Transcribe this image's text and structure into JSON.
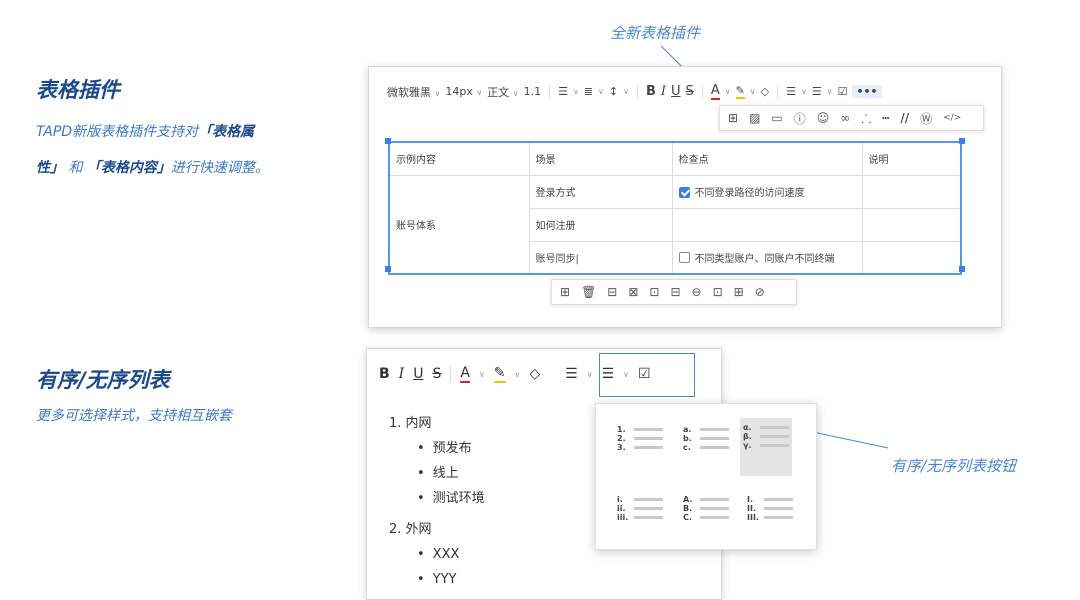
{
  "section1": {
    "title": "表格插件",
    "desc_line1": "TAPD新版表格插件支持对",
    "desc_bold1": "「表格属",
    "desc_bold2": "性」",
    "desc_mid": "和",
    "desc_bold3": "「表格内容」",
    "desc_end": "进行快速调整。",
    "callout": "全新表格插件"
  },
  "editor1": {
    "font": "微软雅黑",
    "size": "14px",
    "paragraph": "正文",
    "lineheight": "1.1",
    "toolbar_icons": [
      "align-icon",
      "indent-icon",
      "line-spacing-icon",
      "bold-icon",
      "italic-icon",
      "underline-icon",
      "strikethrough-icon",
      "font-color-icon",
      "highlight-icon",
      "clear-format-icon",
      "ordered-list-icon",
      "unordered-list-icon",
      "checklist-icon",
      "more-icon"
    ],
    "table": {
      "headers": [
        "示例内容",
        "场景",
        "检查点",
        "说明"
      ],
      "group": "账号体系",
      "rows": [
        {
          "scene": "登录方式",
          "check": "不同登录路径的访问速度",
          "checked": true
        },
        {
          "scene": "如何注册",
          "check": "",
          "checked": null
        },
        {
          "scene": "账号同步",
          "check": "不同类型账户、同账户不同终端",
          "checked": false
        }
      ]
    }
  },
  "section2": {
    "title": "有序/无序列表",
    "desc": "更多可选择样式，支持相互嵌套",
    "callout": "有序/无序列表按钮"
  },
  "editor2": {
    "toolbar_labels": [
      "B",
      "I",
      "U",
      "S",
      "A"
    ],
    "list_styles": [
      {
        "markers": [
          "1.",
          "2.",
          "3."
        ],
        "selected": false
      },
      {
        "markers": [
          "a.",
          "b.",
          "c."
        ],
        "selected": false
      },
      {
        "markers": [
          "α.",
          "β.",
          "γ."
        ],
        "selected": true
      },
      {
        "markers": [
          "i.",
          "ii.",
          "iii."
        ],
        "selected": false
      },
      {
        "markers": [
          "A.",
          "B.",
          "C."
        ],
        "selected": false
      },
      {
        "markers": [
          "I.",
          "II.",
          "III."
        ],
        "selected": false
      }
    ],
    "list": [
      {
        "label": "1. 内网",
        "children": [
          "预发布",
          "线上",
          "测试环境"
        ]
      },
      {
        "label": "2. 外网",
        "children": [
          "XXX",
          "YYY"
        ]
      }
    ]
  },
  "colors": {
    "accent": "#3d7fe0",
    "title": "#1d4a8c",
    "desc": "#3b78c6"
  }
}
